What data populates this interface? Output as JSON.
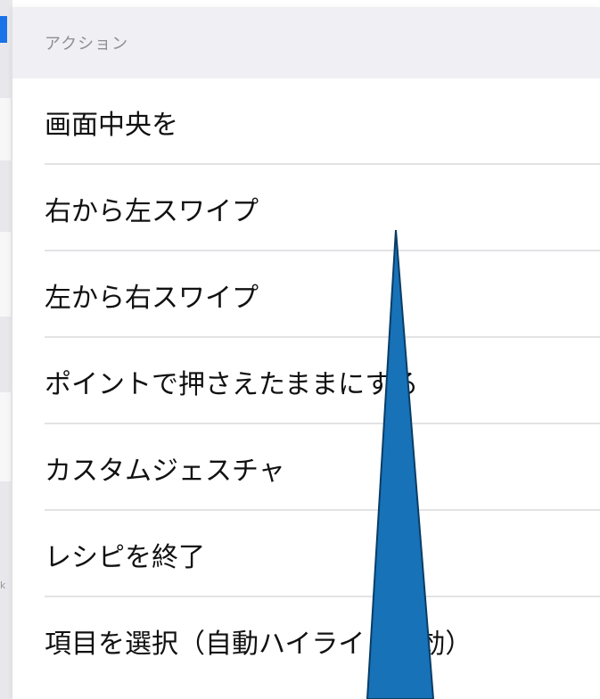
{
  "section": {
    "header": "アクション"
  },
  "actions": [
    {
      "label": "画面中央を"
    },
    {
      "label": "右から左スワイプ"
    },
    {
      "label": "左から右スワイプ"
    },
    {
      "label": "ポイントで押さえたままにする"
    },
    {
      "label": "カスタムジェスチャ"
    },
    {
      "label": "レシピを終了"
    },
    {
      "label": "項目を選択（自動ハイライト有効）"
    }
  ],
  "background": {
    "fragment": "k"
  },
  "colors": {
    "header_bg": "#efeff4",
    "header_text": "#8e8e93",
    "separator": "#e3e3e6",
    "arrow": "#1772b8",
    "arrow_outline": "#0a3d66"
  }
}
